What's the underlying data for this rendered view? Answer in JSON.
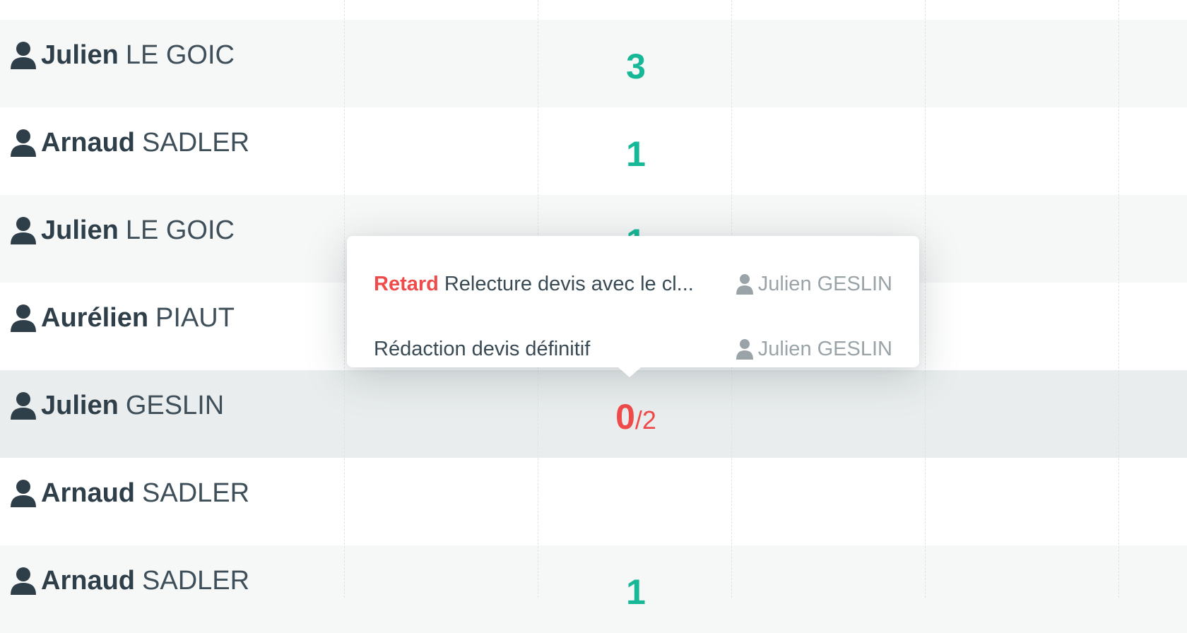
{
  "rows": [
    {
      "first": "Julien",
      "last": "LE GOIC",
      "count": "3"
    },
    {
      "first": "Arnaud",
      "last": "SADLER",
      "count": "1"
    },
    {
      "first": "Julien",
      "last": "LE GOIC",
      "count": "1"
    },
    {
      "first": "Aurélien",
      "last": "PIAUT",
      "count": ""
    },
    {
      "first": "Julien",
      "last": "GESLIN",
      "count": "0",
      "total": "/2"
    },
    {
      "first": "Arnaud",
      "last": "SADLER",
      "count": ""
    },
    {
      "first": "Arnaud",
      "last": "SADLER",
      "count": "1"
    }
  ],
  "popover": {
    "tasks": [
      {
        "tag": "Retard",
        "title": "Relecture devis avec le cl...",
        "assignee": "Julien GESLIN"
      },
      {
        "tag": "",
        "title": "Rédaction devis définitif",
        "assignee": "Julien GESLIN"
      }
    ]
  },
  "colors": {
    "ok": "#17b897",
    "late": "#ef4b4b",
    "text": "#3a4a55",
    "muted": "#9aa3a8"
  },
  "icons": {
    "person": "user-icon"
  }
}
